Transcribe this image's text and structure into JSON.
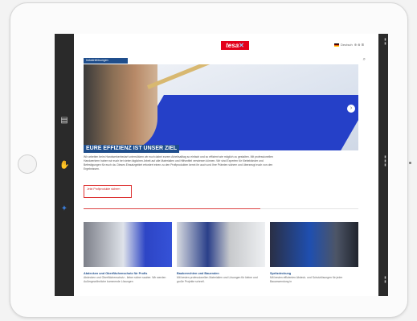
{
  "brand": {
    "logo_text": "tesa",
    "logo_mark": "✕"
  },
  "language": {
    "label": "Deutsch",
    "extra": "⊕ ⊗ ⊞"
  },
  "breadcrumb": {
    "label": "Industrielösungen"
  },
  "hero": {
    "title": "EURE EFFIZIENZ IST UNSER ZIEL",
    "intro": "Wir arbeiten beim Handwerkerbedarf unterstützen wir euch dabei eurem Arbeitsalltag so einfach und so effizient wie möglich zu gestalten. Mit professionellen Handwerkern haben wir euch bei vielen täglichen Arbeit auf alle Materialien und Hilfsmittel verwiesen können. Wir sind Experten für Klebebänder und Befestigungen für euch da. Dieses Einsatzgebiet erfordert einen zu den Profiprodukten kennt ihr auch und Ihre Prämien sichern und überzeugt euch von den Ergebnissen.",
    "cta": "Jetzt Profiprodukte sichern"
  },
  "cards": [
    {
      "title": "Abdecken und Oberflächenschutz für Profis",
      "text": "Abdecken und Oberflächenschutz - lieber sicher sauber. Wir werden Außergewöhnliche kommende Lösungen"
    },
    {
      "title": "Bauberechten und Bauenden",
      "text": "Mit besten professionellen Materialien und Lösungen für kleine und große Projekte schnell."
    },
    {
      "title": "Spritzdeckung",
      "text": "Mit besten effizienten Abdeck- und Schutzlösungen für jeder Bauanwendung in"
    }
  ],
  "icons": {
    "rail": [
      "document-icon",
      "hand-icon",
      "star-icon"
    ],
    "search": "search-icon",
    "hero_arrow": "chevron-right-icon"
  },
  "colors": {
    "brand_red": "#e3001b",
    "brand_blue": "#1f4e8c",
    "rail": "#2a2a2a"
  }
}
